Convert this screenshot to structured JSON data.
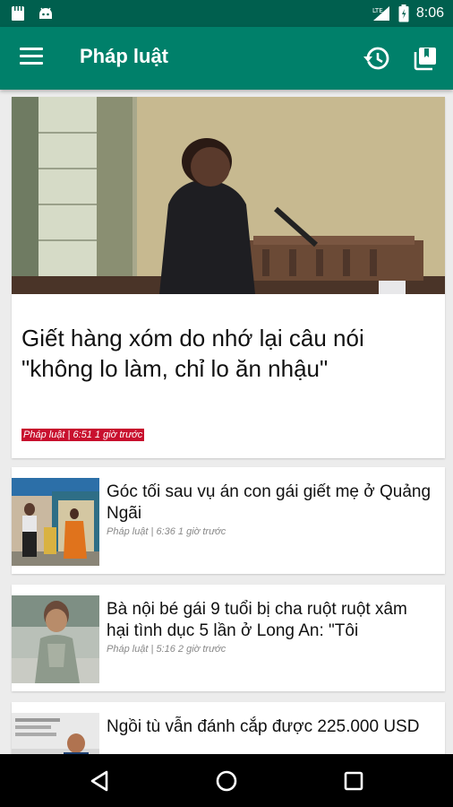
{
  "status_bar": {
    "time": "8:06",
    "icons": [
      "notification-doc-icon",
      "android-icon",
      "lte-signal-icon",
      "battery-icon"
    ]
  },
  "app_bar": {
    "title": "Pháp luật",
    "icons": [
      "menu-icon",
      "history-icon",
      "library-icon"
    ]
  },
  "hero": {
    "title": "Giết hàng xóm do nhớ lại câu nói \"không lo làm, chỉ lo ăn nhậu\"",
    "meta": "Pháp luật | 6:51 1 giờ trước"
  },
  "articles": [
    {
      "title": "Góc tối sau vụ án con gái giết mẹ ở Quảng Ngãi",
      "meta": "Pháp luật | 6:36 1 giờ trước"
    },
    {
      "title": "Bà nội bé gái 9 tuổi bị cha ruột ruột xâm hại tình dục 5 lần ở Long An: \"Tôi",
      "meta": "Pháp luật | 5:16 2 giờ trước"
    },
    {
      "title": "Ngồi tù vẫn đánh cắp được 225.000 USD",
      "meta": ""
    }
  ],
  "colors": {
    "status_bar": "#005f4e",
    "app_bar": "#00806a",
    "meta_highlight": "#c8102e",
    "nav_bar": "#000000"
  },
  "nav_bar": {
    "icons": [
      "back-icon",
      "home-icon",
      "recents-icon"
    ]
  }
}
